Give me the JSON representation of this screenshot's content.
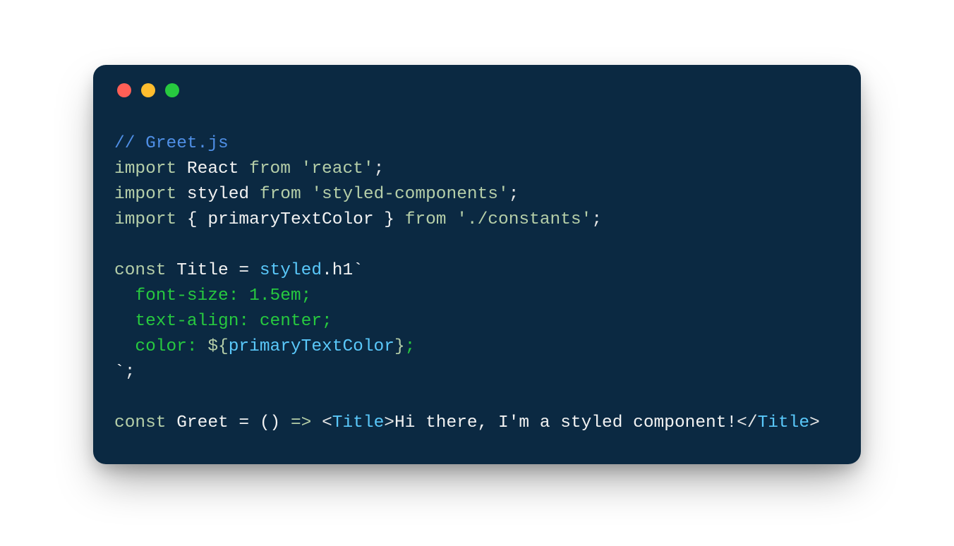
{
  "colors": {
    "window_bg": "#0b2942",
    "dot_red": "#ff5f56",
    "dot_yellow": "#ffbd2e",
    "dot_green": "#27c93f",
    "comment": "#4f8fe6",
    "keyword": "#b5cea8",
    "string": "#b5cea8",
    "func": "#5ac8fa",
    "css": "#27c93f",
    "plain": "#f2f2f2"
  },
  "code": {
    "l1": {
      "full": "// Greet.js"
    },
    "l2": {
      "kw_import": "import",
      "ident": "React",
      "kw_from": "from",
      "str": "'react'",
      "semi": ";"
    },
    "l3": {
      "kw_import": "import",
      "ident": "styled",
      "kw_from": "from",
      "str": "'styled-components'",
      "semi": ";"
    },
    "l4": {
      "kw_import": "import",
      "lb": "{ ",
      "ident": "primaryTextColor",
      "rb": " }",
      "kw_from": "from",
      "str": "'./constants'",
      "semi": ";"
    },
    "l6": {
      "kw_const": "const",
      "ident": "Title",
      "eq": " = ",
      "call": "styled",
      "dot": ".",
      "tag": "h1",
      "tick": "`"
    },
    "l7": {
      "css": "font-size: 1.5em;"
    },
    "l8": {
      "css": "text-align: center;"
    },
    "l9": {
      "css_a": "color: ",
      "dl": "${",
      "var": "primaryTextColor",
      "dr": "}",
      "css_b": ";"
    },
    "l10": {
      "tick": "`",
      "semi": ";"
    },
    "l12": {
      "kw_const": "const",
      "ident": "Greet",
      "eq": " = ",
      "parens": "()",
      "arrow": " => ",
      "lt1": "<",
      "tag1": "Title",
      "gt1": ">",
      "text": "Hi there, I'm a styled component!",
      "lt2": "</",
      "tag2": "Title",
      "gt2": ">"
    }
  }
}
